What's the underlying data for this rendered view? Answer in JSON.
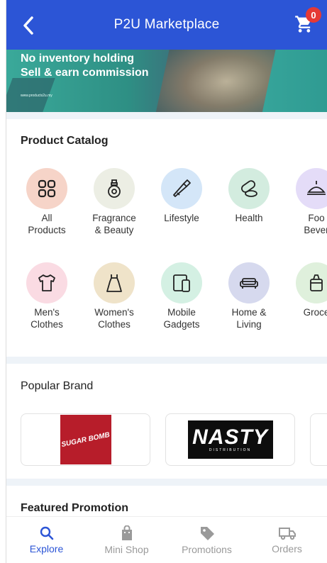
{
  "header": {
    "title": "P2U Marketplace",
    "cart_count": "0"
  },
  "banner": {
    "line1": "No inventory holding",
    "line2": "Sell & earn commission",
    "url": "www.products2u.my"
  },
  "catalog": {
    "title": "Product Catalog",
    "items": [
      {
        "label": "All\nProducts",
        "icon": "grid-icon",
        "bg": "#f6d4c8",
        "stroke": "#222"
      },
      {
        "label": "Fragrance\n& Beauty",
        "icon": "perfume-icon",
        "bg": "#eceee4",
        "stroke": "#222"
      },
      {
        "label": "Lifestyle",
        "icon": "lipstick-icon",
        "bg": "#d4e6f8",
        "stroke": "#222"
      },
      {
        "label": "Health",
        "icon": "pill-icon",
        "bg": "#d3ecdf",
        "stroke": "#222"
      },
      {
        "label": "Foo\nBever",
        "icon": "food-icon",
        "bg": "#e4dcf8",
        "stroke": "#222"
      },
      {
        "label": "Men's\nClothes",
        "icon": "tshirt-icon",
        "bg": "#fadbe3",
        "stroke": "#222"
      },
      {
        "label": "Women's\nClothes",
        "icon": "dress-icon",
        "bg": "#efe3c9",
        "stroke": "#222"
      },
      {
        "label": "Mobile\nGadgets",
        "icon": "phone-icon",
        "bg": "#d4f0e3",
        "stroke": "#222"
      },
      {
        "label": "Home &\nLiving",
        "icon": "sofa-icon",
        "bg": "#d6d9ee",
        "stroke": "#222"
      },
      {
        "label": "Groce",
        "icon": "grocery-icon",
        "bg": "#dff0dc",
        "stroke": "#222"
      }
    ]
  },
  "brands": {
    "title": "Popular Brand",
    "items": [
      {
        "name": "SUGAR BOMB",
        "icon": "sugarbomb-logo"
      },
      {
        "name": "NASTY",
        "sub": "DISTRIBUTION",
        "icon": "nasty-logo"
      }
    ]
  },
  "promo": {
    "title": "Featured Promotion"
  },
  "nav": {
    "items": [
      {
        "label": "Explore",
        "icon": "search-icon",
        "active": true
      },
      {
        "label": "Mini Shop",
        "icon": "shopping-bag-icon",
        "active": false
      },
      {
        "label": "Promotions",
        "icon": "tag-icon",
        "active": false
      },
      {
        "label": "Orders",
        "icon": "truck-icon",
        "active": false
      }
    ]
  },
  "colors": {
    "primary": "#2c55d6",
    "inactive": "#9a9a9a",
    "badge": "#e53935"
  }
}
